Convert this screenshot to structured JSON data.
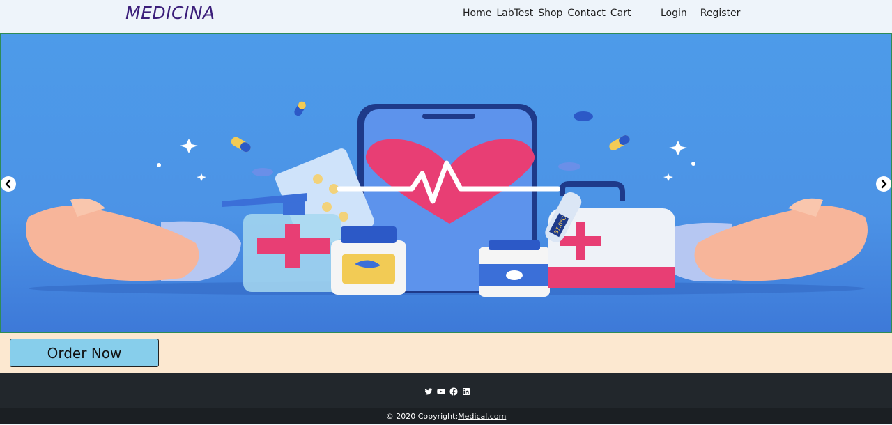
{
  "navbar": {
    "brand": "MEDICINA",
    "links": [
      "Home",
      "LabTest",
      "Shop",
      "Contact",
      "Cart"
    ],
    "login": "Login",
    "register": "Register"
  },
  "carousel": {
    "prev_icon": "chevron-left-icon",
    "next_icon": "chevron-right-icon",
    "thermometer_text": "37.0°C"
  },
  "order": {
    "button_label": "Order Now"
  },
  "footer": {
    "social_icons": [
      "twitter-icon",
      "youtube-icon",
      "facebook-icon",
      "linkedin-icon"
    ],
    "copyright_prefix": "© 2020 Copyright:",
    "copyright_link": "Medical.com"
  },
  "colors": {
    "brand": "#3b1e7a",
    "hero_bg": "#4d9be9",
    "order_bar": "#fce8d0",
    "order_button": "#87ceeb",
    "footer": "#22272c"
  }
}
